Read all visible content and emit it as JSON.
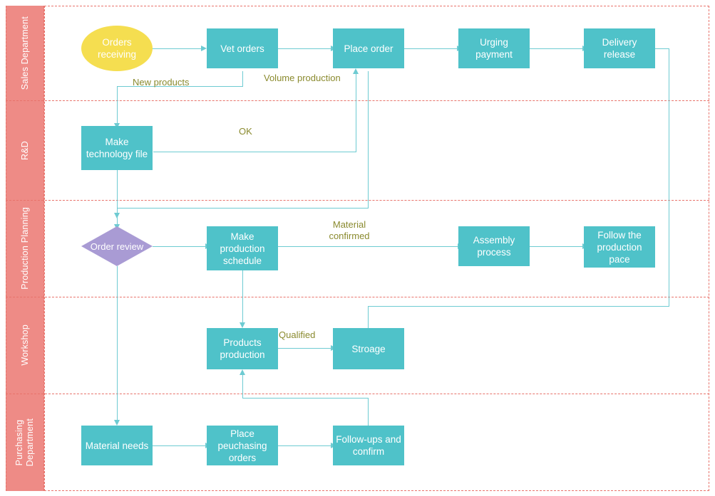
{
  "diagram": {
    "title": "Order fulfillment swimlane flowchart",
    "colors": {
      "lane_band": "#ee8b86",
      "lane_divider": "#e8736b",
      "process_box": "#4fc2c9",
      "start_ellipse": "#f5de50",
      "decision_diamond": "#a99bd4",
      "connector": "#6ecbd2",
      "edge_label_text": "#8a8a2e",
      "node_text": "#ffffff"
    }
  },
  "lanes": [
    {
      "id": "sales",
      "label": "Sales Department"
    },
    {
      "id": "rnd",
      "label": "R&D"
    },
    {
      "id": "planning",
      "label": "Production Planning"
    },
    {
      "id": "workshop",
      "label": "Workshop"
    },
    {
      "id": "purchasing",
      "label": "Purchasing\nDepartment"
    }
  ],
  "nodes": [
    {
      "id": "orders_receiving",
      "label": "Orders\nreceiving",
      "shape": "ellipse",
      "lane": "sales"
    },
    {
      "id": "vet_orders",
      "label": "Vet orders",
      "shape": "process",
      "lane": "sales"
    },
    {
      "id": "place_order",
      "label": "Place order",
      "shape": "process",
      "lane": "sales"
    },
    {
      "id": "urging_payment",
      "label": "Urging\npayment",
      "shape": "process",
      "lane": "sales"
    },
    {
      "id": "delivery_release",
      "label": "Delivery\nrelease",
      "shape": "process",
      "lane": "sales"
    },
    {
      "id": "make_tech_file",
      "label": "Make\ntechnology file",
      "shape": "process",
      "lane": "rnd"
    },
    {
      "id": "order_review",
      "label": "Order review",
      "shape": "diamond",
      "lane": "planning"
    },
    {
      "id": "make_prod_schedule",
      "label": "Make\nproduction\nschedule",
      "shape": "process",
      "lane": "planning"
    },
    {
      "id": "assembly_process",
      "label": "Assembly\nprocess",
      "shape": "process",
      "lane": "planning"
    },
    {
      "id": "follow_prod_pace",
      "label": "Follow the\nproduction\npace",
      "shape": "process",
      "lane": "planning"
    },
    {
      "id": "products_production",
      "label": "Products\nproduction",
      "shape": "process",
      "lane": "workshop"
    },
    {
      "id": "stroage",
      "label": "Stroage",
      "shape": "process",
      "lane": "workshop"
    },
    {
      "id": "material_needs",
      "label": "Material needs",
      "shape": "process",
      "lane": "purchasing"
    },
    {
      "id": "place_purchasing",
      "label": "Place\npeuchasing\norders",
      "shape": "process",
      "lane": "purchasing"
    },
    {
      "id": "followups_confirm",
      "label": "Follow-ups and\nconfirm",
      "shape": "process",
      "lane": "purchasing"
    }
  ],
  "edge_labels": [
    {
      "id": "new_products",
      "text": "New products",
      "from": "vet_orders",
      "to": "make_tech_file"
    },
    {
      "id": "volume_production",
      "text": "Volume  production",
      "from": "vet_orders",
      "to": "place_order"
    },
    {
      "id": "ok",
      "text": "OK",
      "from": "make_tech_file",
      "to": "place_order"
    },
    {
      "id": "material_confirmed",
      "text": "Material\nconfirmed",
      "from": "make_prod_schedule",
      "to": "assembly_process"
    },
    {
      "id": "qualified",
      "text": "Qualified",
      "from": "products_production",
      "to": "stroage"
    }
  ]
}
